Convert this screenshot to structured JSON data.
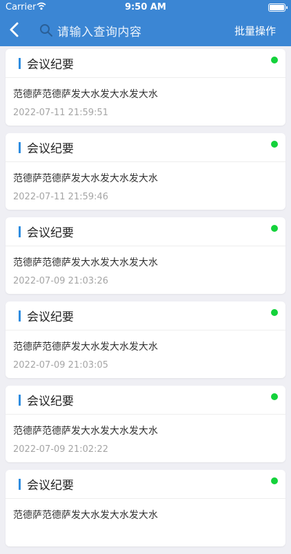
{
  "status": {
    "carrier": "Carrier",
    "time": "9:50 AM"
  },
  "header": {
    "search_placeholder": "请输入查询内容",
    "batch_label": "批量操作"
  },
  "items": [
    {
      "title": "会议纪要",
      "content": "范德萨范德萨发大水发大水发大水",
      "date": "2022-07-11 21:59:51"
    },
    {
      "title": "会议纪要",
      "content": "范德萨范德萨发大水发大水发大水",
      "date": "2022-07-11 21:59:46"
    },
    {
      "title": "会议纪要",
      "content": "范德萨范德萨发大水发大水发大水",
      "date": "2022-07-09 21:03:26"
    },
    {
      "title": "会议纪要",
      "content": "范德萨范德萨发大水发大水发大水",
      "date": "2022-07-09 21:03:05"
    },
    {
      "title": "会议纪要",
      "content": "范德萨范德萨发大水发大水发大水",
      "date": "2022-07-09 21:02:22"
    },
    {
      "title": "会议纪要",
      "content": "范德萨范德萨发大水发大水发大水",
      "date": ""
    }
  ],
  "colors": {
    "header": "#3b86d4",
    "accent_bar": "#2f8de0",
    "status_dot": "#14d23b"
  },
  "icons": {
    "back": "chevron-left-icon",
    "search": "search-icon",
    "wifi": "wifi-icon",
    "battery": "battery-icon"
  }
}
